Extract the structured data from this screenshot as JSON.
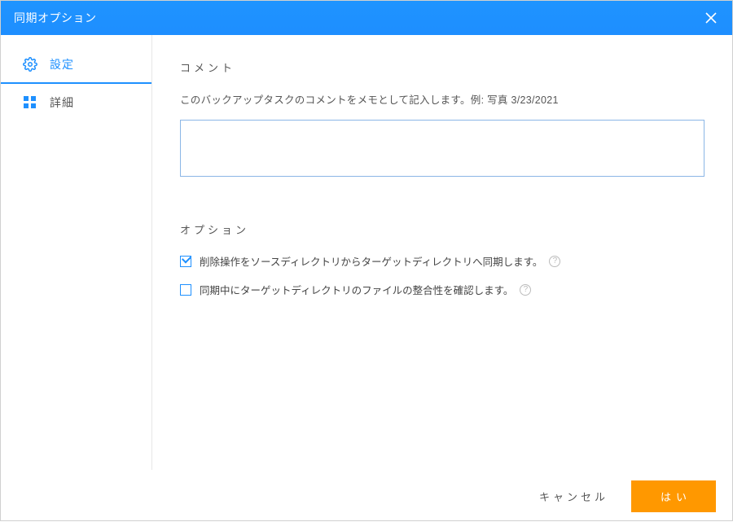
{
  "titlebar": {
    "title": "同期オプション"
  },
  "sidebar": {
    "items": [
      {
        "label": "設定"
      },
      {
        "label": "詳細"
      }
    ]
  },
  "section_comment": {
    "title": "コメント",
    "hint": "このバックアップタスクのコメントをメモとして記入します。例: 写真 3/23/2021",
    "value": ""
  },
  "section_options": {
    "title": "オプション",
    "opt1": {
      "checked": true,
      "label": "削除操作をソースディレクトリからターゲットディレクトリへ同期します。"
    },
    "opt2": {
      "checked": false,
      "label": "同期中にターゲットディレクトリのファイルの整合性を確認します。"
    }
  },
  "footer": {
    "cancel": "キャンセル",
    "ok": "はい"
  }
}
